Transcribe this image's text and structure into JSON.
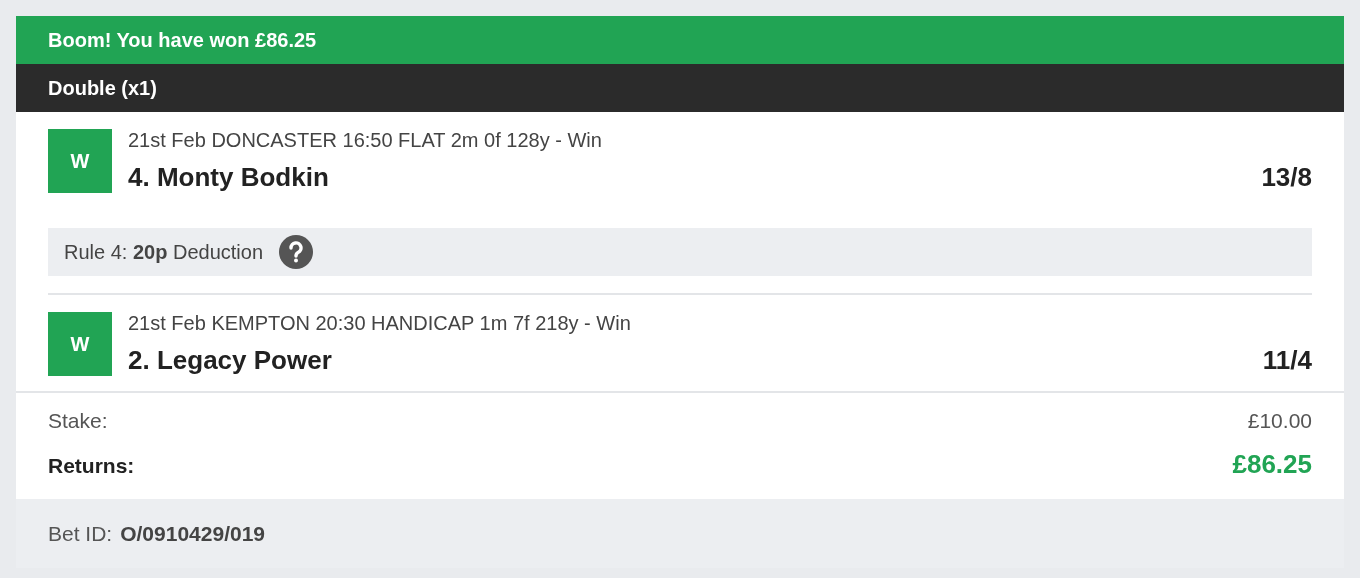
{
  "banner": {
    "text": "Boom! You have won £86.25"
  },
  "bet_type": {
    "title": "Double (x1)"
  },
  "selections": [
    {
      "result": "W",
      "event": "21st Feb DONCASTER 16:50 FLAT 2m 0f 128y - Win",
      "runner": "4. Monty Bodkin",
      "odds": "13/8",
      "rule4": "Rule 4: **20p** Deduction"
    },
    {
      "result": "W",
      "event": "21st Feb KEMPTON 20:30 HANDICAP 1m 7f 218y - Win",
      "runner": "2. Legacy Power",
      "odds": "11/4"
    }
  ],
  "totals": {
    "stake_label": "Stake:",
    "stake": "£10.00",
    "returns_label": "Returns:",
    "returns": "£86.25"
  },
  "footer": {
    "label": "Bet ID:",
    "bet_id": "O/0910429/019"
  }
}
